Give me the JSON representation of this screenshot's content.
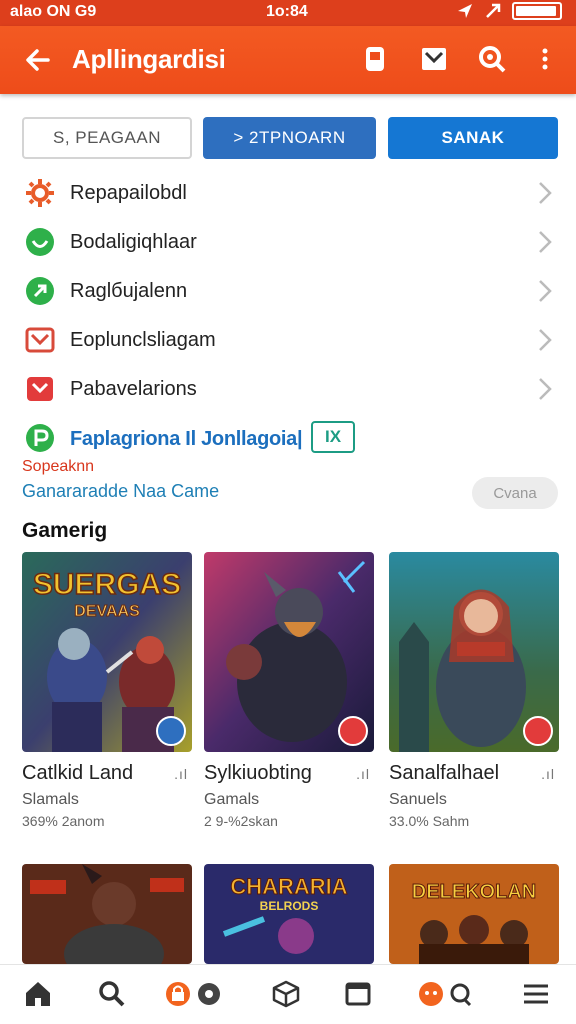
{
  "status_bar": {
    "left": "alao ON G9",
    "time": "1o:84"
  },
  "app_bar": {
    "title": "Apllingardisi",
    "icons": [
      "back-arrow-icon",
      "tablet-icon",
      "inbox-icon",
      "search-settings-icon",
      "more-vert-icon"
    ]
  },
  "buttons": {
    "outline_label": "S, PEAGAAN",
    "primary_label": "> 2TPNOARN",
    "secondary_label": "SANAK"
  },
  "menu": [
    {
      "label": "Repapailobdl",
      "icon": "sun-gear-icon",
      "color": "#e85c2a"
    },
    {
      "label": "Bodaligiqhlaar",
      "icon": "check-circle-icon",
      "color": "#2eb04a"
    },
    {
      "label": "Raglбujalenn",
      "icon": "plus-leaf-icon",
      "color": "#2eb04a"
    },
    {
      "label": "Eoplunclsliagam",
      "icon": "mail-icon",
      "color": "#d84a3a"
    },
    {
      "label": "Pabavelarions",
      "icon": "image-icon",
      "color": "#e23b3b"
    }
  ],
  "promo": {
    "title": "Faplagriona Il Jonllagoia|",
    "badge": "IX",
    "sub_red": "Sopeaknn",
    "sub_blue": "Ganararadde Naa Came",
    "button": "Cvana"
  },
  "section_title": "Gamerig",
  "games": [
    {
      "name": "Catlkid Land",
      "category": "Slamals",
      "meta": "369% 2anom",
      "art_title": "SUERGAS",
      "art_subtitle": "DEVAAS"
    },
    {
      "name": "Sylkiuobting",
      "category": "Gamals",
      "meta": "2 9-%2skan"
    },
    {
      "name": "Sanalfalhael",
      "category": "Sanuels",
      "meta": "33.0% Sahm"
    }
  ],
  "games_row2": [
    {
      "art_title": "CHARARIA",
      "art_subtitle": "BELRODS"
    },
    {
      "art_title": "DELEKOLAN"
    }
  ],
  "bottom_nav": [
    "home-icon",
    "search-icon",
    "lock-icon",
    "cube-icon",
    "square-icon",
    "bot-icon",
    "menu-icon"
  ],
  "colors": {
    "accent": "#ee4c1a",
    "blue": "#1577d3"
  }
}
